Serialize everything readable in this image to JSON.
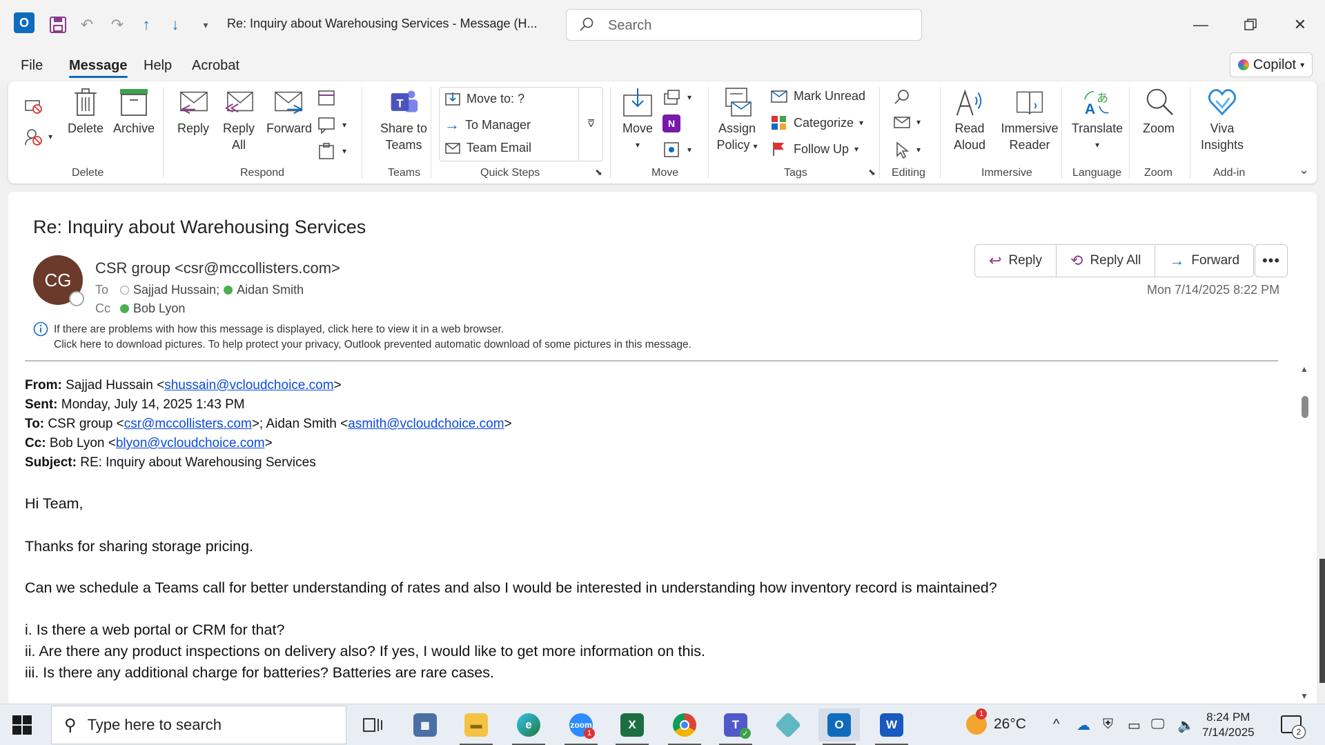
{
  "window": {
    "title": "Re: Inquiry about Warehousing Services  -  Message (H...",
    "search_placeholder": "Search"
  },
  "menu": {
    "tabs": [
      "File",
      "Message",
      "Help",
      "Acrobat"
    ],
    "active": "Message",
    "copilot": "Copilot"
  },
  "ribbon": {
    "delete_group": {
      "label": "Delete",
      "delete": "Delete",
      "archive": "Archive"
    },
    "respond_group": {
      "label": "Respond",
      "reply": "Reply",
      "reply_all_1": "Reply",
      "reply_all_2": "All",
      "forward": "Forward"
    },
    "teams_group": {
      "label": "Teams",
      "share_1": "Share to",
      "share_2": "Teams"
    },
    "quick_steps": {
      "label": "Quick Steps",
      "items": [
        "Move to: ?",
        "To Manager",
        "Team Email"
      ]
    },
    "move_group": {
      "label": "Move",
      "move": "Move"
    },
    "tags_group": {
      "label": "Tags",
      "assign_1": "Assign",
      "assign_2": "Policy",
      "mark_unread": "Mark Unread",
      "categorize": "Categorize",
      "follow_up": "Follow Up"
    },
    "editing_group": {
      "label": "Editing"
    },
    "immersive_group": {
      "label": "Immersive",
      "read_1": "Read",
      "read_2": "Aloud",
      "immersive_1": "Immersive",
      "immersive_2": "Reader"
    },
    "language_group": {
      "label": "Language",
      "translate": "Translate"
    },
    "zoom_group": {
      "label": "Zoom",
      "zoom": "Zoom"
    },
    "addin_group": {
      "label": "Add-in",
      "viva_1": "Viva",
      "viva_2": "Insights"
    }
  },
  "message": {
    "subject": "Re: Inquiry about Warehousing Services",
    "avatar_initials": "CG",
    "sender": "CSR group <csr@mccollisters.com>",
    "to_label": "To",
    "to_1": "Sajjad Hussain;",
    "to_2": "Aidan Smith",
    "cc_label": "Cc",
    "cc_1": "Bob Lyon",
    "actions": {
      "reply": "Reply",
      "reply_all": "Reply All",
      "forward": "Forward",
      "more": "•••"
    },
    "datetime": "Mon 7/14/2025 8:22 PM",
    "info_1": "If there are problems with how this message is displayed, click here to view it in a web browser.",
    "info_2": "Click here to download pictures. To help protect your privacy, Outlook prevented automatic download of some pictures in this message."
  },
  "quoted": {
    "from_label": "From:",
    "from_name": " Sajjad Hussain <",
    "from_email": "shussain@vcloudchoice.com",
    "sent_label": "Sent:",
    "sent_value": " Monday, July 14, 2025 1:43 PM",
    "to_label": "To:",
    "to_a": " CSR group <",
    "to_email_1": "csr@mccollisters.com",
    "to_b": ">; Aidan Smith <",
    "to_email_2": "asmith@vcloudchoice.com",
    "cc_label": "Cc:",
    "cc_a": " Bob Lyon <",
    "cc_email": "blyon@vcloudchoice.com",
    "subject_label": "Subject:",
    "subject_value": " RE: Inquiry about Warehousing Services"
  },
  "body": {
    "greeting": "Hi Team,",
    "p1": "Thanks for sharing storage pricing.",
    "p2": "Can we schedule a Teams call for better understanding of rates and also I would be interested in understanding how inventory record is maintained?",
    "q1": "i. Is there a web portal or CRM for that?",
    "q2": "ii. Are there any product inspections on delivery also? If yes, I would like to get more information on this.",
    "q3": "iii. Is there any additional charge for batteries? Batteries are rare cases."
  },
  "taskbar": {
    "search_placeholder": "Type here to search",
    "weather": "26°C",
    "weather_badge": "1",
    "zoom_badge": "1",
    "time": "8:24 PM",
    "date": "7/14/2025",
    "notification_count": "2"
  }
}
